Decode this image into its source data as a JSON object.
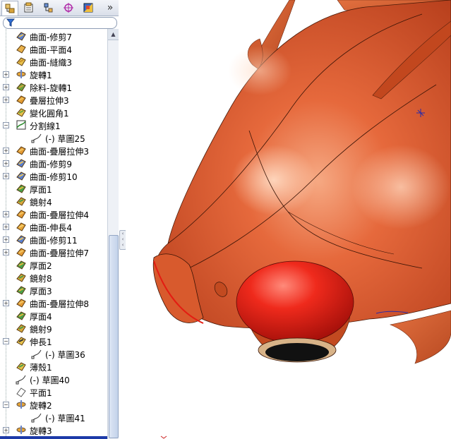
{
  "tree": {
    "items": [
      {
        "label": "曲面-修剪7",
        "icon": "surface-trim-icon",
        "indent": 1,
        "expander": "",
        "depth": 0
      },
      {
        "label": "曲面-平面4",
        "icon": "planar-surface-icon",
        "indent": 1,
        "expander": "",
        "depth": 0
      },
      {
        "label": "曲面-縫織3",
        "icon": "knit-surface-icon",
        "indent": 1,
        "expander": "",
        "depth": 0
      },
      {
        "label": "旋轉1",
        "icon": "revolve-icon",
        "indent": 1,
        "expander": "+",
        "depth": 0
      },
      {
        "label": "除料-旋轉1",
        "icon": "revolve-cut-icon",
        "indent": 1,
        "expander": "+",
        "depth": 0
      },
      {
        "label": "疊層拉伸3",
        "icon": "loft-icon",
        "indent": 1,
        "expander": "+",
        "depth": 0
      },
      {
        "label": "變化圓角1",
        "icon": "variable-fillet-icon",
        "indent": 1,
        "expander": "",
        "depth": 0
      },
      {
        "label": "分割線1",
        "icon": "split-line-icon",
        "indent": 1,
        "expander": "−",
        "depth": 0
      },
      {
        "label": "(-) 草圖25",
        "icon": "sketch-icon",
        "indent": 2,
        "expander": "",
        "depth": 1
      },
      {
        "label": "曲面-疊層拉伸3",
        "icon": "surface-loft-icon",
        "indent": 1,
        "expander": "+",
        "depth": 0
      },
      {
        "label": "曲面-修剪9",
        "icon": "surface-trim-icon",
        "indent": 1,
        "expander": "+",
        "depth": 0
      },
      {
        "label": "曲面-修剪10",
        "icon": "surface-trim-icon",
        "indent": 1,
        "expander": "+",
        "depth": 0
      },
      {
        "label": "厚面1",
        "icon": "thicken-icon",
        "indent": 1,
        "expander": "",
        "depth": 0
      },
      {
        "label": "鏡射4",
        "icon": "mirror-icon",
        "indent": 1,
        "expander": "",
        "depth": 0
      },
      {
        "label": "曲面-疊層拉伸4",
        "icon": "surface-loft-icon",
        "indent": 1,
        "expander": "+",
        "depth": 0
      },
      {
        "label": "曲面-伸長4",
        "icon": "surface-extend-icon",
        "indent": 1,
        "expander": "+",
        "depth": 0
      },
      {
        "label": "曲面-修剪11",
        "icon": "surface-trim-icon",
        "indent": 1,
        "expander": "+",
        "depth": 0
      },
      {
        "label": "曲面-疊層拉伸7",
        "icon": "surface-loft-icon",
        "indent": 1,
        "expander": "+",
        "depth": 0
      },
      {
        "label": "厚面2",
        "icon": "thicken-icon",
        "indent": 1,
        "expander": "",
        "depth": 0
      },
      {
        "label": "鏡射8",
        "icon": "mirror-icon",
        "indent": 1,
        "expander": "",
        "depth": 0
      },
      {
        "label": "厚面3",
        "icon": "thicken-icon",
        "indent": 1,
        "expander": "",
        "depth": 0
      },
      {
        "label": "曲面-疊層拉伸8",
        "icon": "surface-loft-icon",
        "indent": 1,
        "expander": "+",
        "depth": 0
      },
      {
        "label": "厚面4",
        "icon": "thicken-icon",
        "indent": 1,
        "expander": "",
        "depth": 0
      },
      {
        "label": "鏡射9",
        "icon": "mirror-icon",
        "indent": 1,
        "expander": "",
        "depth": 0
      },
      {
        "label": "伸長1",
        "icon": "extrude-icon",
        "indent": 1,
        "expander": "−",
        "depth": 0
      },
      {
        "label": "(-) 草圖36",
        "icon": "sketch-icon",
        "indent": 2,
        "expander": "",
        "depth": 1
      },
      {
        "label": "薄殼1",
        "icon": "shell-icon",
        "indent": 1,
        "expander": "",
        "depth": 0
      },
      {
        "label": "(-) 草圖40",
        "icon": "sketch-icon",
        "indent": 1,
        "expander": "",
        "depth": 0
      },
      {
        "label": "平面1",
        "icon": "plane-icon",
        "indent": 1,
        "expander": "",
        "depth": 0
      },
      {
        "label": "旋轉2",
        "icon": "revolve-icon",
        "indent": 1,
        "expander": "−",
        "depth": 0
      },
      {
        "label": "(-) 草圖41",
        "icon": "sketch-icon",
        "indent": 2,
        "expander": "",
        "depth": 1
      },
      {
        "label": "旋轉3",
        "icon": "revolve-icon",
        "indent": 1,
        "expander": "+",
        "depth": 0
      }
    ]
  },
  "toolbar": {
    "tabs": [
      "feature-manager-icon",
      "property-manager-icon",
      "configuration-manager-icon",
      "dimxpert-icon",
      "display-manager-icon"
    ],
    "more_label": "»"
  },
  "colors": {
    "body": "#d2552a",
    "highlight": "#f3a07a",
    "eye": "#e5231c",
    "tree_accent": "#1d3aa8"
  }
}
